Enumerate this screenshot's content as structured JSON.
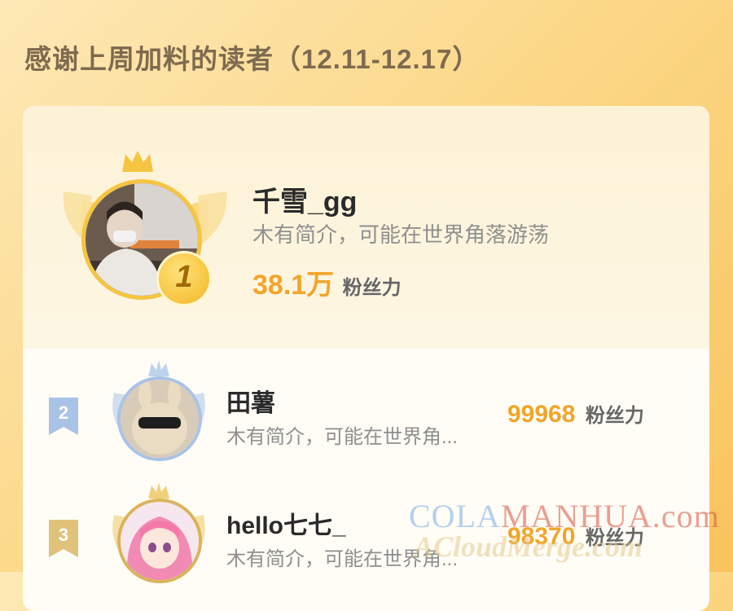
{
  "title": "感谢上周加料的读者（12.11-12.17）",
  "readers": [
    {
      "rank": "1",
      "name": "千雪_gg",
      "intro": "木有简介，可能在世界角落游荡",
      "fans": "38.1万",
      "fans_unit": "粉丝力"
    },
    {
      "rank": "2",
      "name": "田薯",
      "intro": "木有简介，可能在世界角...",
      "fans": "99968",
      "fans_unit": "粉丝力"
    },
    {
      "rank": "3",
      "name": "hello七七_",
      "intro": "木有简介，可能在世界角...",
      "fans": "98370",
      "fans_unit": "粉丝力"
    }
  ],
  "watermark": {
    "line1_a": "COLA",
    "line1_b": "MANHUA.com",
    "line2": "ACloudMerge.com"
  },
  "colors": {
    "accent": "#f2a52a",
    "background": "#fcd98a",
    "card": "#fffdf6"
  }
}
